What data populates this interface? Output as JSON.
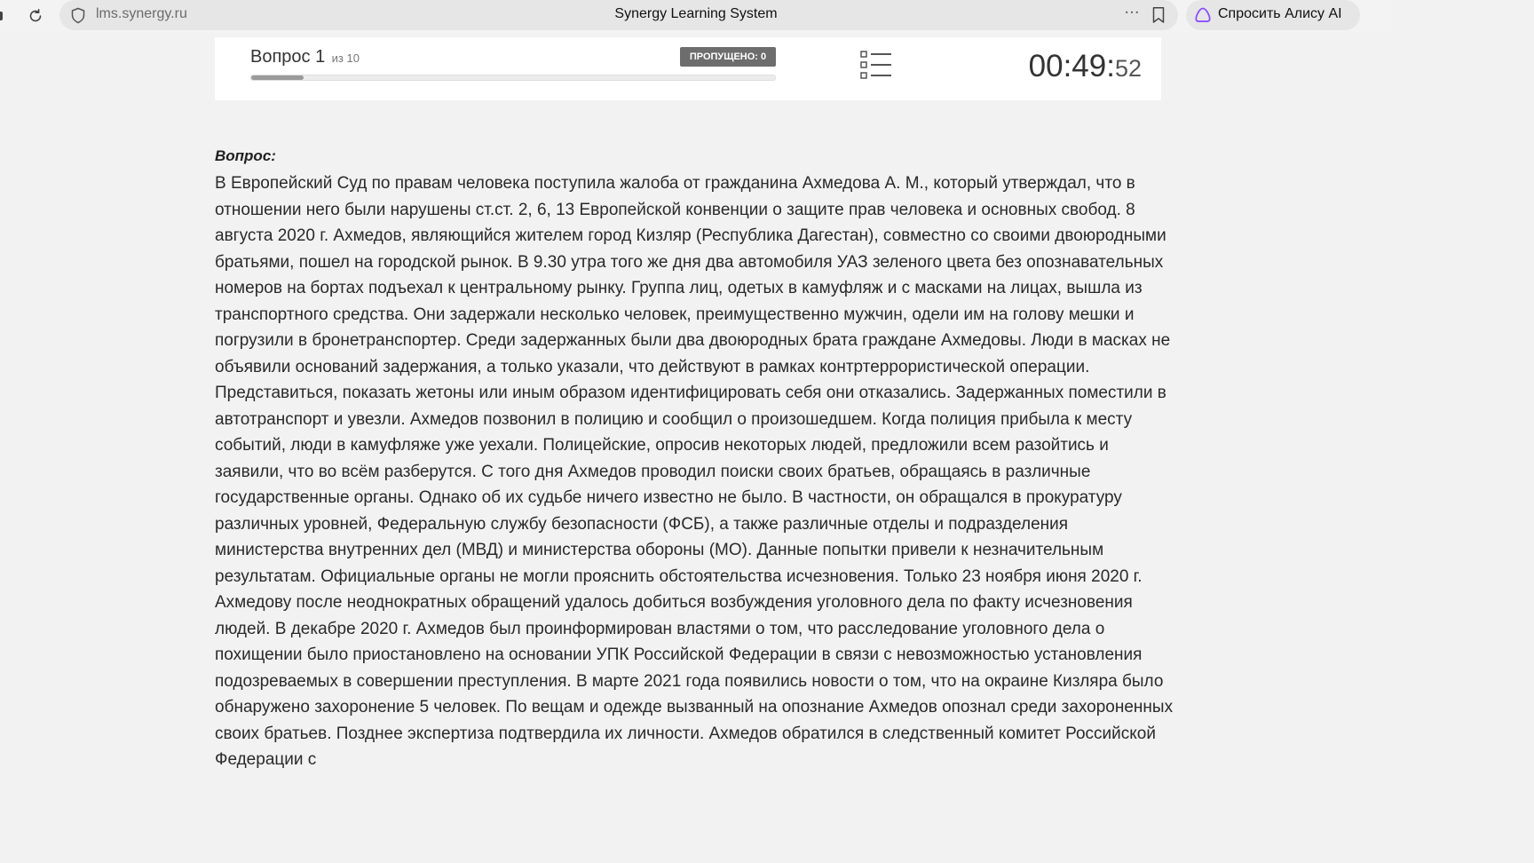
{
  "browser": {
    "url": "lms.synergy.ru",
    "page_title": "Synergy Learning System",
    "more_label": "···",
    "alice_label": "Спросить Алису AI"
  },
  "test": {
    "question_label": "Вопрос 1",
    "question_total": "из 10",
    "progress": 0.1,
    "skipped_label": "ПРОПУЩЕНО: 0",
    "timer_main": "00:49:",
    "timer_seconds": "52"
  },
  "question": {
    "heading": "Вопрос:",
    "text": "В Европейский Суд по правам человека поступила жалоба от гражданина Ахмедова А. М., который утверждал, что в отношении него были нарушены ст.ст. 2, 6, 13 Европейской конвенции о защите прав человека и основных свобод. 8 августа 2020 г. Ахмедов, являющийся жителем город Кизляр (Республика Дагестан), совместно со своими двоюродными братьями, пошел на городской рынок. В 9.30 утра того же дня два автомобиля УАЗ зеленого цвета без опознавательных номеров на бортах подъехал к центральному рынку. Группа лиц, одетых в камуфляж и с масками на лицах, вышла из транспортного средства. Они задержали несколько человек, преимущественно мужчин, одели им на голову мешки и погрузили в бронетранспортер. Среди задержанных были два двоюродных брата граждане Ахмедовы. Люди в масках не объявили оснований задержания, а только указали, что действуют в рамках контртеррористической операции. Представиться, показать жетоны или иным образом идентифицировать себя они отказались. Задержанных поместили в автотранспорт и увезли. Ахмедов позвонил в полицию и сообщил о произошедшем. Когда полиция прибыла к месту событий, люди в камуфляже уже уехали. Полицейские, опросив некоторых людей, предложили всем разойтись и заявили, что во всём разберутся. С того дня Ахмедов проводил поиски своих братьев, обращаясь в различные государственные органы. Однако об их судьбе ничего известно не было. В частности, он обращался в прокуратуру различных уровней, Федеральную службу безопасности (ФСБ), а также различные отделы и подразделения министерства внутренних дел (МВД) и министерства обороны (МО). Данные попытки привели к незначительным результатам. Официальные органы не могли прояснить обстоятельства исчезновения. Только 23 ноября июня 2020 г. Ахмедову после неоднократных обращений удалось добиться возбуждения уголовного дела по факту исчезновения людей. В декабре 2020 г. Ахмедов был проинформирован властями о том, что расследование уголовного дела о похищении было приостановлено на основании УПК Российской Федерации в связи с невозможностью установления подозреваемых в совершении преступления. В марте 2021 года появились новости о том, что на окраине Кизляра было обнаружено захоронение 5 человек. По вещам и одежде вызванный на опознание Ахмедов опознал среди захороненных своих братьев. Позднее экспертиза подтвердила их личности. Ахмедов обратился в следственный комитет Российской Федерации с"
  },
  "icons": {
    "reload": "reload-icon",
    "shield": "shield-icon",
    "bookmark": "bookmark-icon",
    "alice": "alice-icon",
    "question_list": "list-icon"
  },
  "colors": {
    "badge_bg": "#6d6d6d",
    "alice_accent": "#8a4dff",
    "page_bg": "#f2f2f2"
  }
}
